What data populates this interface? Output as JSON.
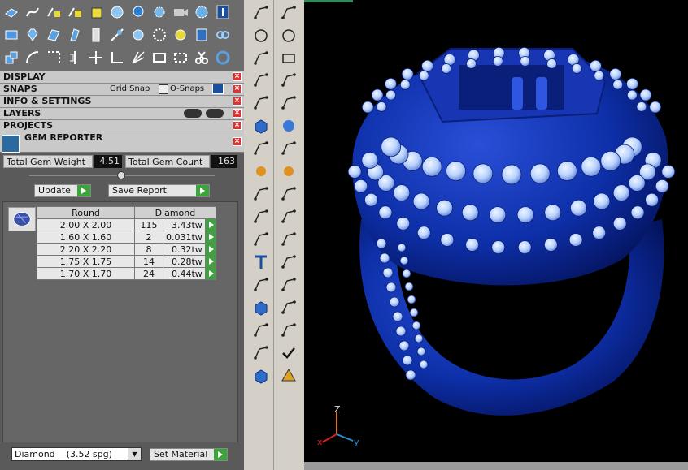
{
  "sections": {
    "display": "DISPLAY",
    "snaps": "SNAPS",
    "grid_snap": "Grid Snap",
    "o_snaps": "O-Snaps",
    "info": "INFO & SETTINGS",
    "layers": "LAYERS",
    "projects": "PROJECTS",
    "gem_reporter": "GEM REPORTER"
  },
  "gem_reporter": {
    "total_weight_label": "Total Gem Weight",
    "total_weight_value": "4.51",
    "total_count_label": "Total Gem Count",
    "total_count_value": "163",
    "update_label": "Update",
    "save_report_label": "Save Report",
    "table_headers": [
      "Round",
      "Diamond"
    ],
    "rows": [
      {
        "size": "2.00 X 2.00",
        "count": "115",
        "weight": "3.43tw"
      },
      {
        "size": "1.60 X 1.60",
        "count": "2",
        "weight": "0.031tw"
      },
      {
        "size": "2.20 X 2.20",
        "count": "8",
        "weight": "0.32tw"
      },
      {
        "size": "1.75 X 1.75",
        "count": "14",
        "weight": "0.28tw"
      },
      {
        "size": "1.70 X 1.70",
        "count": "24",
        "weight": "0.44tw"
      }
    ],
    "material_select": "Diamond    (3.52 spg)",
    "set_material_label": "Set Material"
  },
  "viewport": {
    "axis_labels": {
      "z": "Z",
      "x": "x",
      "y": "y"
    },
    "colors": {
      "ring": "#0d2fa8",
      "gems": "#bcd6ff",
      "background": "#000000"
    }
  }
}
